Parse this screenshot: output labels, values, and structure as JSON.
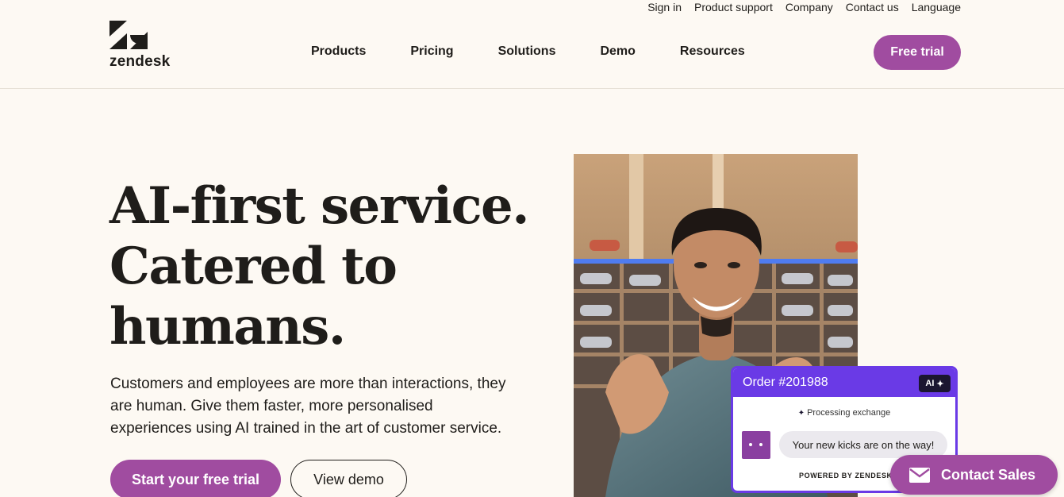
{
  "brand": {
    "name": "zendesk",
    "accent": "#a04ca0",
    "ai_purple": "#6a3ae6"
  },
  "utility_nav": [
    {
      "label": "Sign in"
    },
    {
      "label": "Product support"
    },
    {
      "label": "Company"
    },
    {
      "label": "Contact us"
    },
    {
      "label": "Language"
    }
  ],
  "main_nav": [
    {
      "label": "Products"
    },
    {
      "label": "Pricing"
    },
    {
      "label": "Solutions"
    },
    {
      "label": "Demo"
    },
    {
      "label": "Resources"
    }
  ],
  "header": {
    "cta_label": "Free trial"
  },
  "hero": {
    "headline": [
      "AI-first service.",
      "Catered to",
      "humans."
    ],
    "subtext": [
      "Customers and employees are more than interactions, they",
      "are human. Give them faster, more personalised",
      "experiences using AI trained in the art of customer service."
    ],
    "primary_cta": "Start your free trial",
    "secondary_cta": "View demo"
  },
  "order_card": {
    "title": "Order #201988",
    "badge": "AI",
    "status": "Processing exchange",
    "message": "Your new kicks are on the way!",
    "footer": "POWERED BY ZENDESK AI"
  },
  "contact_sales": {
    "label": "Contact Sales",
    "icon": "mail-icon"
  },
  "icons": [
    "zendesk-logo",
    "sparkle-icon",
    "bot-avatar-icon",
    "mail-icon"
  ]
}
